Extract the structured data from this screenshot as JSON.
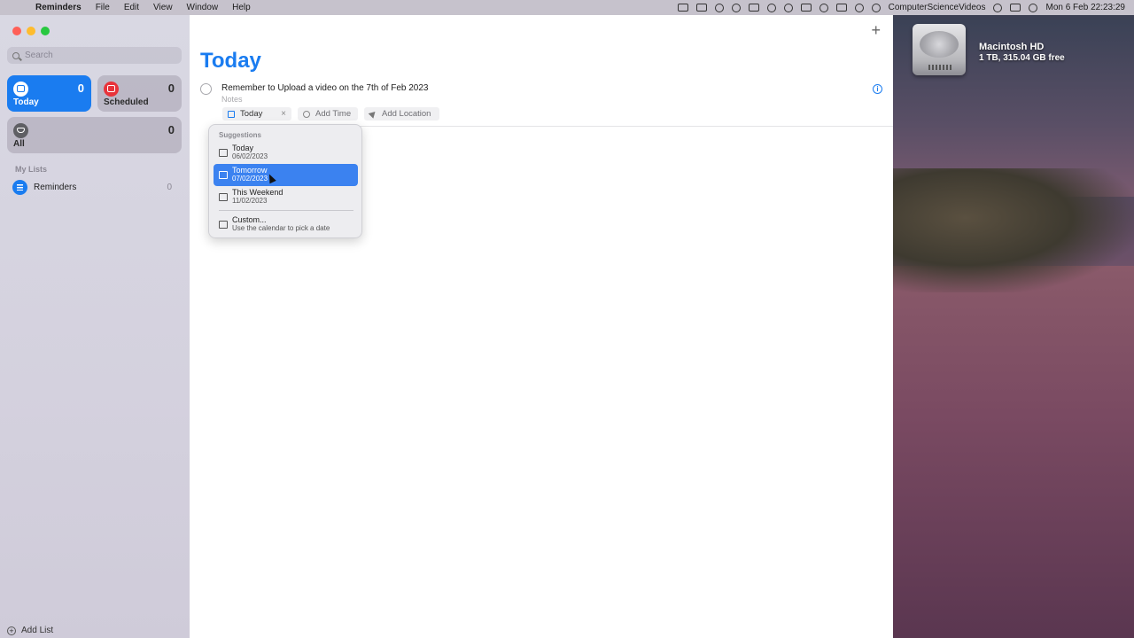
{
  "menubar": {
    "app_name": "Reminders",
    "items": [
      "File",
      "Edit",
      "View",
      "Window",
      "Help"
    ],
    "user": "ComputerScienceVideos",
    "clock": "Mon 6 Feb  22:23:29"
  },
  "desktop": {
    "disk_name": "Macintosh HD",
    "disk_info": "1 TB, 315.04 GB free"
  },
  "sidebar": {
    "search_placeholder": "Search",
    "smart_lists": {
      "today": {
        "label": "Today",
        "count": "0"
      },
      "scheduled": {
        "label": "Scheduled",
        "count": "0"
      },
      "all": {
        "label": "All",
        "count": "0"
      }
    },
    "my_lists_header": "My Lists",
    "lists": [
      {
        "label": "Reminders",
        "count": "0"
      }
    ],
    "add_list_label": "Add List"
  },
  "main": {
    "title": "Today",
    "add_symbol": "+",
    "reminder": {
      "title": "Remember to Upload a video on the 7th of Feb 2023",
      "notes_placeholder": "Notes",
      "info_symbol": "i",
      "date_chip": "Today",
      "clear_symbol": "×",
      "time_chip": "Add Time",
      "location_chip": "Add Location"
    }
  },
  "popover": {
    "header": "Suggestions",
    "options": [
      {
        "title": "Today",
        "subtitle": "06/02/2023",
        "selected": false
      },
      {
        "title": "Tomorrow",
        "subtitle": "07/02/2023",
        "selected": true
      },
      {
        "title": "This Weekend",
        "subtitle": "11/02/2023",
        "selected": false
      },
      {
        "title": "Custom...",
        "subtitle": "Use the calendar to pick a date",
        "selected": false
      }
    ]
  },
  "colors": {
    "accent": "#1a7cf0",
    "scheduled": "#e8333a",
    "selection": "#3b82f0"
  }
}
